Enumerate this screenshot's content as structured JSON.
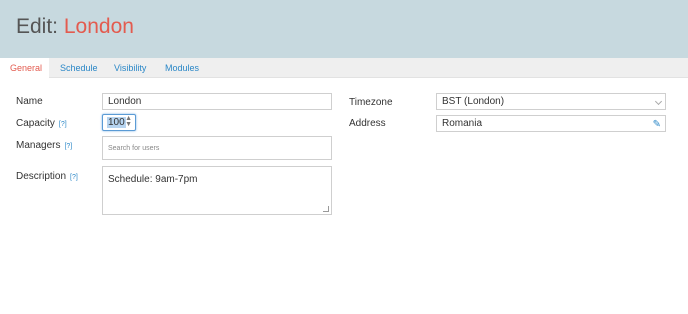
{
  "header": {
    "title_prefix": "Edit: ",
    "title_name": "London"
  },
  "tabs": [
    {
      "label": "General",
      "active": true
    },
    {
      "label": "Schedule"
    },
    {
      "label": "Visibility"
    },
    {
      "label": "Modules"
    }
  ],
  "form": {
    "name_label": "Name",
    "name_value": "London",
    "capacity_label": "Capacity",
    "capacity_value": "100",
    "managers_label": "Managers",
    "managers_placeholder": "Search for users",
    "description_label": "Description",
    "description_value": "Schedule: 9am-7pm",
    "help_text": "[?]",
    "timezone_label": "Timezone",
    "timezone_value": "BST (London)",
    "address_label": "Address",
    "address_value": "Romania"
  },
  "icons": {
    "timezone_dropdown": "chevron-down-icon",
    "address_edit": "pencil-icon",
    "capacity_spinner": "spinner-icon"
  },
  "colors": {
    "header_bg": "#c7d9df",
    "accent": "#e35b4f",
    "link": "#2a87c7"
  }
}
